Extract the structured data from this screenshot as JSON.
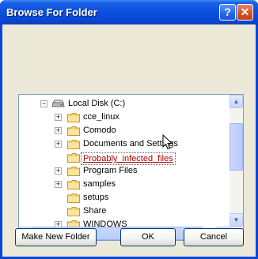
{
  "window": {
    "title": "Browse For Folder",
    "help_glyph": "?",
    "close_glyph": "✕"
  },
  "tree": {
    "root": {
      "label": "Local Disk (C:)",
      "expander": "−",
      "icon": "drive-icon"
    },
    "items": [
      {
        "label": "cce_linux",
        "expander": "+"
      },
      {
        "label": "Comodo",
        "expander": "+"
      },
      {
        "label": "Documents and Settings",
        "expander": "+"
      },
      {
        "label": "Probably_infected_files",
        "expander": "",
        "selected": true
      },
      {
        "label": "Program Files",
        "expander": "+"
      },
      {
        "label": "samples",
        "expander": "+"
      },
      {
        "label": "setups",
        "expander": ""
      },
      {
        "label": "Share",
        "expander": ""
      },
      {
        "label": "WINDOWS",
        "expander": "+"
      }
    ]
  },
  "scrollbar": {
    "up": "▲",
    "down": "▼",
    "left": "◀",
    "right": "▶"
  },
  "buttons": {
    "new_folder": "Make New Folder",
    "ok": "OK",
    "cancel": "Cancel"
  },
  "colors": {
    "title_bar": "#0a50dc",
    "dialog_bg": "#ece9d8",
    "selected_text": "#b00000",
    "folder": "#f5d67a"
  }
}
